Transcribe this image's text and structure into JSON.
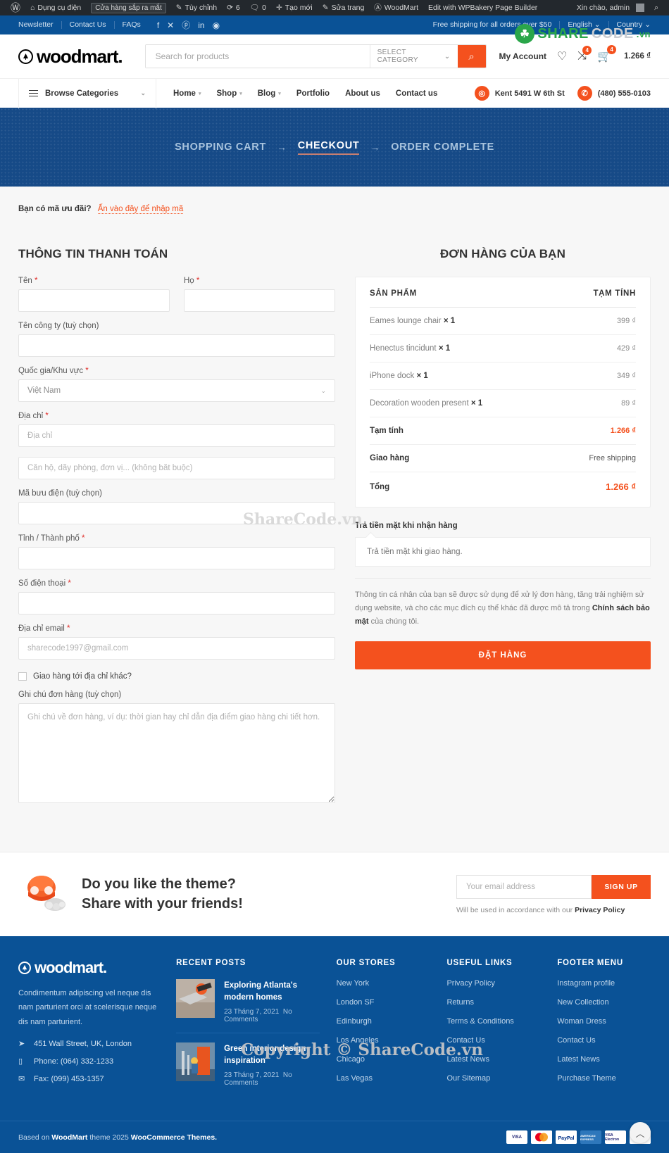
{
  "adminbar": {
    "wp_logo_icon": "wordpress-icon",
    "items": [
      {
        "icon": "dashboard-icon",
        "label": "Dụng cụ điện"
      },
      {
        "icon": "",
        "label": "Cửa hàng sắp ra mắt",
        "pill": true
      },
      {
        "icon": "pencil-icon",
        "label": "Tùy chỉnh"
      },
      {
        "icon": "refresh-icon",
        "label": "6"
      },
      {
        "icon": "comment-icon",
        "label": "0"
      },
      {
        "icon": "plus-icon",
        "label": "Tạo mới"
      },
      {
        "icon": "edit-icon",
        "label": "Sửa trang"
      },
      {
        "icon": "woodmart-icon",
        "label": "WoodMart"
      },
      {
        "icon": "",
        "label": "Edit with WPBakery Page Builder"
      }
    ],
    "greeting": "Xin chào, admin",
    "search_icon": "search-icon"
  },
  "watermark": {
    "brand_circle": "★",
    "share": "SHARE",
    "code": "CODE",
    "vn": ".vn",
    "center_text": "ShareCode.vn",
    "copyright": "Copyright © ShareCode.vn"
  },
  "topbar": {
    "links": [
      "Newsletter",
      "Contact Us",
      "FAQs"
    ],
    "socials": [
      "facebook-icon",
      "x-twitter-icon",
      "pinterest-icon",
      "linkedin-icon",
      "telegram-icon"
    ],
    "shipping_note": "Free shipping for all orders over $50",
    "language": "English",
    "country": "Country"
  },
  "header": {
    "logo_text": "woodmart.",
    "search": {
      "placeholder": "Search for products",
      "value": "",
      "category_label": "SELECT CATEGORY",
      "search_icon": "search-icon"
    },
    "my_account": "My Account",
    "wishlist_icon": "heart-icon",
    "compare_icon": "compare-icon",
    "compare_count": "4",
    "cart_icon": "cart-icon",
    "cart_count": "4",
    "cart_amount": "1.266 ₫"
  },
  "nav": {
    "browse_label": "Browse Categories",
    "menu": [
      {
        "label": "Home",
        "caret": true
      },
      {
        "label": "Shop",
        "caret": true
      },
      {
        "label": "Blog",
        "caret": true
      },
      {
        "label": "Portfolio",
        "caret": false
      },
      {
        "label": "About us",
        "caret": false
      },
      {
        "label": "Contact us",
        "caret": false
      }
    ],
    "address_icon": "map-pin-icon",
    "address": "Kent 5491 W 6th St",
    "phone_icon": "phone-icon",
    "phone": "(480) 555-0103"
  },
  "breadcrumb": {
    "steps": [
      {
        "label": "SHOPPING CART",
        "active": false
      },
      {
        "label": "CHECKOUT",
        "active": true
      },
      {
        "label": "ORDER COMPLETE",
        "active": false
      }
    ],
    "arrow": "→"
  },
  "checkout": {
    "coupon_prompt": "Bạn có mã ưu đãi?",
    "coupon_link": "Ấn vào đây để nhập mã",
    "billing_title": "THÔNG TIN THANH TOÁN",
    "fields": {
      "first_name": {
        "label": "Tên",
        "required": true,
        "value": "",
        "placeholder": ""
      },
      "last_name": {
        "label": "Họ",
        "required": true,
        "value": "",
        "placeholder": ""
      },
      "company": {
        "label": "Tên công ty (tuỳ chọn)",
        "required": false,
        "value": "",
        "placeholder": ""
      },
      "country": {
        "label": "Quốc gia/Khu vực",
        "required": true,
        "value": "Việt Nam"
      },
      "address1": {
        "label": "Địa chỉ",
        "required": true,
        "value": "",
        "placeholder": "Địa chỉ"
      },
      "address2": {
        "label": "",
        "required": false,
        "value": "",
        "placeholder": "Căn hộ, dãy phòng, đơn vị... (không bắt buộc)"
      },
      "postcode": {
        "label": "Mã bưu điện (tuỳ chọn)",
        "required": false,
        "value": "",
        "placeholder": ""
      },
      "city": {
        "label": "Tỉnh / Thành phố",
        "required": true,
        "value": "",
        "placeholder": ""
      },
      "phone": {
        "label": "Số điện thoại",
        "required": true,
        "value": "",
        "placeholder": ""
      },
      "email": {
        "label": "Địa chỉ email",
        "required": true,
        "value": "",
        "placeholder": "sharecode1997@gmail.com"
      },
      "ship_different": {
        "label": "Giao hàng tới địa chỉ khác?",
        "checked": false
      },
      "order_notes": {
        "label": "Ghi chú đơn hàng (tuỳ chọn)",
        "value": "",
        "placeholder": "Ghi chú về đơn hàng, ví dụ: thời gian hay chỉ dẫn địa điểm giao hàng chi tiết hơn."
      }
    }
  },
  "order": {
    "title": "ĐƠN HÀNG CỦA BẠN",
    "head_product": "SẢN PHẨM",
    "head_subtotal": "TẠM TÍNH",
    "items": [
      {
        "name": "Eames lounge chair",
        "qty": "× 1",
        "price": "399 ₫"
      },
      {
        "name": "Henectus tincidunt",
        "qty": "× 1",
        "price": "429 ₫"
      },
      {
        "name": "iPhone dock",
        "qty": "× 1",
        "price": "349 ₫"
      },
      {
        "name": "Decoration wooden present",
        "qty": "× 1",
        "price": "89 ₫"
      }
    ],
    "subtotal_label": "Tạm tính",
    "subtotal_value": "1.266 ₫",
    "shipping_label": "Giao hàng",
    "shipping_value": "Free shipping",
    "total_label": "Tổng",
    "total_value": "1.266 ₫",
    "payment_title": "Trả tiền mặt khi nhận hàng",
    "payment_desc": "Trả tiền mặt khi giao hàng.",
    "privacy_pre": "Thông tin cá nhân của bạn sẽ được sử dụng để xử lý đơn hàng, tăng trải nghiệm sử dụng website, và cho các mục đích cụ thể khác đã được mô tả trong ",
    "privacy_link": "Chính sách bảo mật",
    "privacy_post": " của chúng tôi.",
    "place_order": "ĐẶT HÀNG"
  },
  "newsletter": {
    "line1": "Do you like the theme?",
    "line2": "Share with your friends!",
    "email_placeholder": "Your email address",
    "email_value": "",
    "signup": "SIGN UP",
    "note_pre": "Will be used in accordance with our ",
    "note_link": "Privacy Policy"
  },
  "footer": {
    "logo_text": "woodmart.",
    "description": "Condimentum adipiscing vel neque dis nam parturient orci at scelerisque neque dis nam parturient.",
    "address_icon": "location-icon",
    "address": "451 Wall Street, UK, London",
    "phone_icon": "mobile-icon",
    "phone": "Phone: (064) 332-1233",
    "fax_icon": "envelope-icon",
    "fax": "Fax: (099) 453-1357",
    "recent_posts_title": "RECENT POSTS",
    "posts": [
      {
        "title": "Exploring Atlanta's modern homes",
        "date": "23 Tháng 7, 2021",
        "comments": "No Comments"
      },
      {
        "title": "Green interior design inspiration",
        "date": "23 Tháng 7, 2021",
        "comments": "No Comments"
      }
    ],
    "stores_title": "OUR STORES",
    "stores": [
      "New York",
      "London SF",
      "Edinburgh",
      "Los Angeles",
      "Chicago",
      "Las Vegas"
    ],
    "useful_title": "USEFUL LINKS",
    "useful": [
      "Privacy Policy",
      "Returns",
      "Terms & Conditions",
      "Contact Us",
      "Latest News",
      "Our Sitemap"
    ],
    "menu_title": "FOOTER MENU",
    "menu": [
      "Instagram profile",
      "New Collection",
      "Woman Dress",
      "Contact Us",
      "Latest News",
      "Purchase Theme"
    ],
    "copyright_pre": "Based on ",
    "copyright_brand": "WoodMart",
    "copyright_mid": " theme 2025 ",
    "copyright_brand2": "WooCommerce Themes.",
    "cards": [
      "VISA",
      "MasterCard",
      "PayPal",
      "AMERICAN EXPRESS",
      "VISA Electron",
      "Maestro"
    ],
    "scroll_top_icon": "chevron-up-icon"
  }
}
